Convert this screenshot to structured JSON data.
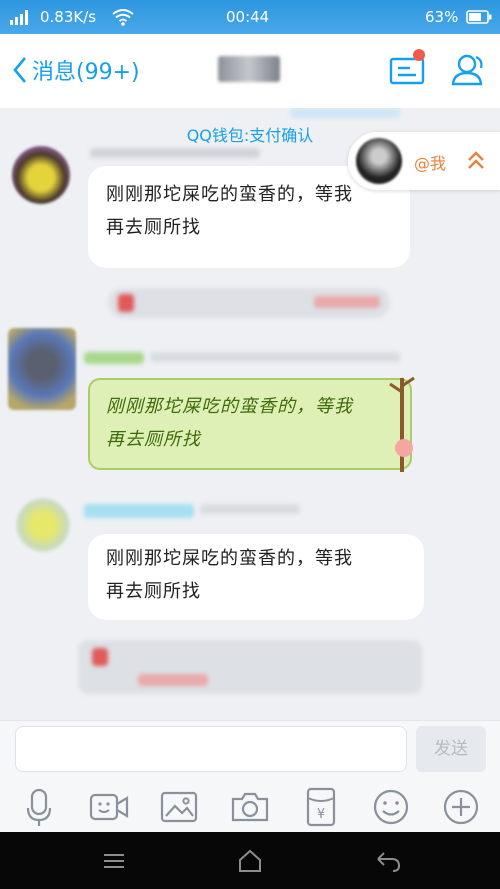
{
  "status_bar": {
    "speed": "0.83K/s",
    "time": "00:44",
    "battery": "63%"
  },
  "header": {
    "back_label": "消息(99+)",
    "icons": [
      "back-chevron-icon",
      "profile-card-icon",
      "contacts-icon"
    ]
  },
  "chat": {
    "system_message": "QQ钱包:支付确认",
    "unread_pill": {
      "label": "@我"
    },
    "messages": [
      {
        "text_line1": "刚刚那坨屎吃的蛮香的，等我",
        "text_line2": "再去厕所找"
      },
      {
        "text_line1": "刚刚那坨屎吃的蛮香的，等我",
        "text_line2": "再去厕所找"
      },
      {
        "text_line1": "刚刚那坨屎吃的蛮香的，等我",
        "text_line2": "再去厕所找"
      }
    ]
  },
  "input_bar": {
    "send_label": "发送"
  },
  "toolbar": {
    "icons": [
      "microphone-icon",
      "video-call-icon",
      "image-icon",
      "camera-icon",
      "red-packet-icon",
      "emoji-icon",
      "plus-icon"
    ]
  },
  "colors": {
    "accent": "#15a0ea",
    "green_bubble": "#dff0b6",
    "orange": "#e8823a"
  }
}
